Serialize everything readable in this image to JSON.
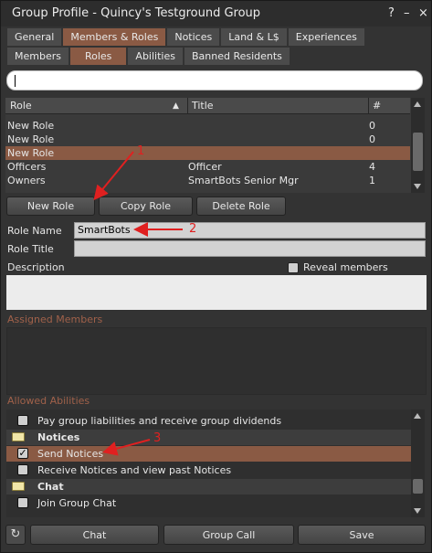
{
  "window": {
    "title": "Group Profile - Quincy's Testground Group",
    "help": "?",
    "minimize": "–",
    "close": "×"
  },
  "tabs_top": [
    "General",
    "Members & Roles",
    "Notices",
    "Land & L$",
    "Experiences"
  ],
  "tabs_sub": [
    "Members",
    "Roles",
    "Abilities",
    "Banned Residents"
  ],
  "roles_table": {
    "headers": {
      "role": "Role",
      "title": "Title",
      "count": "#"
    },
    "rows": [
      {
        "role": "New Role",
        "title": "",
        "count": "0"
      },
      {
        "role": "New Role",
        "title": "",
        "count": "0"
      },
      {
        "role": "New Role",
        "title": "",
        "count": ""
      },
      {
        "role": "Officers",
        "title": "Officer",
        "count": "4"
      },
      {
        "role": "Owners",
        "title": "SmartBots Senior Mgr",
        "count": "1"
      }
    ]
  },
  "role_buttons": {
    "new": "New Role",
    "copy": "Copy Role",
    "delete": "Delete Role"
  },
  "role_form": {
    "name_label": "Role Name",
    "name_value": "SmartBots",
    "title_label": "Role Title",
    "title_value": "",
    "description_label": "Description",
    "reveal_label": "Reveal members"
  },
  "assigned_members_label": "Assigned Members",
  "allowed_abilities_label": "Allowed Abilities",
  "abilities": [
    {
      "type": "item",
      "text": "Pay group liabilities and receive group dividends",
      "checked": false
    },
    {
      "type": "category",
      "text": "Notices"
    },
    {
      "type": "item",
      "text": "Send Notices",
      "checked": true
    },
    {
      "type": "item",
      "text": "Receive Notices and view past Notices",
      "checked": false
    },
    {
      "type": "category",
      "text": "Chat"
    },
    {
      "type": "item",
      "text": "Join Group Chat",
      "checked": false
    }
  ],
  "bottom_buttons": {
    "chat": "Chat",
    "group_call": "Group Call",
    "save": "Save"
  },
  "annotations": [
    "1",
    "2",
    "3"
  ],
  "colors": {
    "accent": "#8a5a44",
    "annotation": "#e02020"
  }
}
